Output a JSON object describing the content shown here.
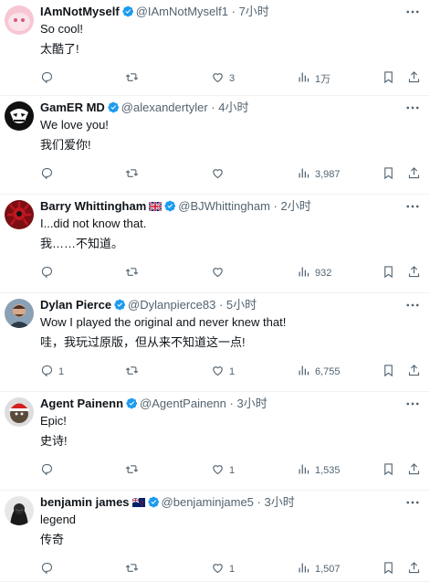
{
  "tweets": [
    {
      "name": "IAmNotMyself",
      "handle": "@IAmNotMyself1",
      "time": "· 7小时",
      "flag": "",
      "line1": "So cool!",
      "line2": "太酷了!",
      "reply_count": "",
      "like_count": "3",
      "view_count": "1万",
      "avatar_icon": "avatar-pink-blob"
    },
    {
      "name": "GamER MD",
      "handle": "@alexandertyler",
      "time": "· 4小时",
      "flag": "",
      "line1": "We love you!",
      "line2": "我们爱你!",
      "reply_count": "",
      "like_count": "",
      "view_count": "3,987",
      "avatar_icon": "avatar-black-mask"
    },
    {
      "name": "Barry Whittingham",
      "handle": "@BJWhittingham",
      "time": "· 2小时",
      "flag": "uk-flag",
      "line1": "I...did not know that.",
      "line2": "我……不知道。",
      "reply_count": "",
      "like_count": "",
      "view_count": "932",
      "avatar_icon": "avatar-red-hydra"
    },
    {
      "name": "Dylan Pierce",
      "handle": "@Dylanpierce83",
      "time": "· 5小时",
      "flag": "",
      "line1": "Wow I played the original and never knew that!",
      "line2": "哇，我玩过原版，但从来不知道这一点!",
      "reply_count": "1",
      "like_count": "1",
      "view_count": "6,755",
      "avatar_icon": "avatar-man-photo"
    },
    {
      "name": "Agent Painenn",
      "handle": "@AgentPainenn",
      "time": "· 3小时",
      "flag": "",
      "line1": "Epic!",
      "line2": "史诗!",
      "reply_count": "",
      "like_count": "1",
      "view_count": "1,535",
      "avatar_icon": "avatar-santa-hat"
    },
    {
      "name": "benjamin james",
      "handle": "@benjaminjame5",
      "time": "· 3小时",
      "flag": "nz-flag",
      "line1": "legend",
      "line2": "传奇",
      "reply_count": "",
      "like_count": "1",
      "view_count": "1,507",
      "avatar_icon": "avatar-dark-photo"
    }
  ],
  "colors": {
    "verified": "#1d9bf0",
    "text": "#0f1419",
    "secondary": "#536471",
    "divider": "#eff3f4"
  },
  "icons": [
    "reply-icon",
    "retweet-icon",
    "like-icon",
    "views-icon",
    "bookmark-icon",
    "share-icon",
    "more-icon",
    "verified-badge-icon"
  ]
}
